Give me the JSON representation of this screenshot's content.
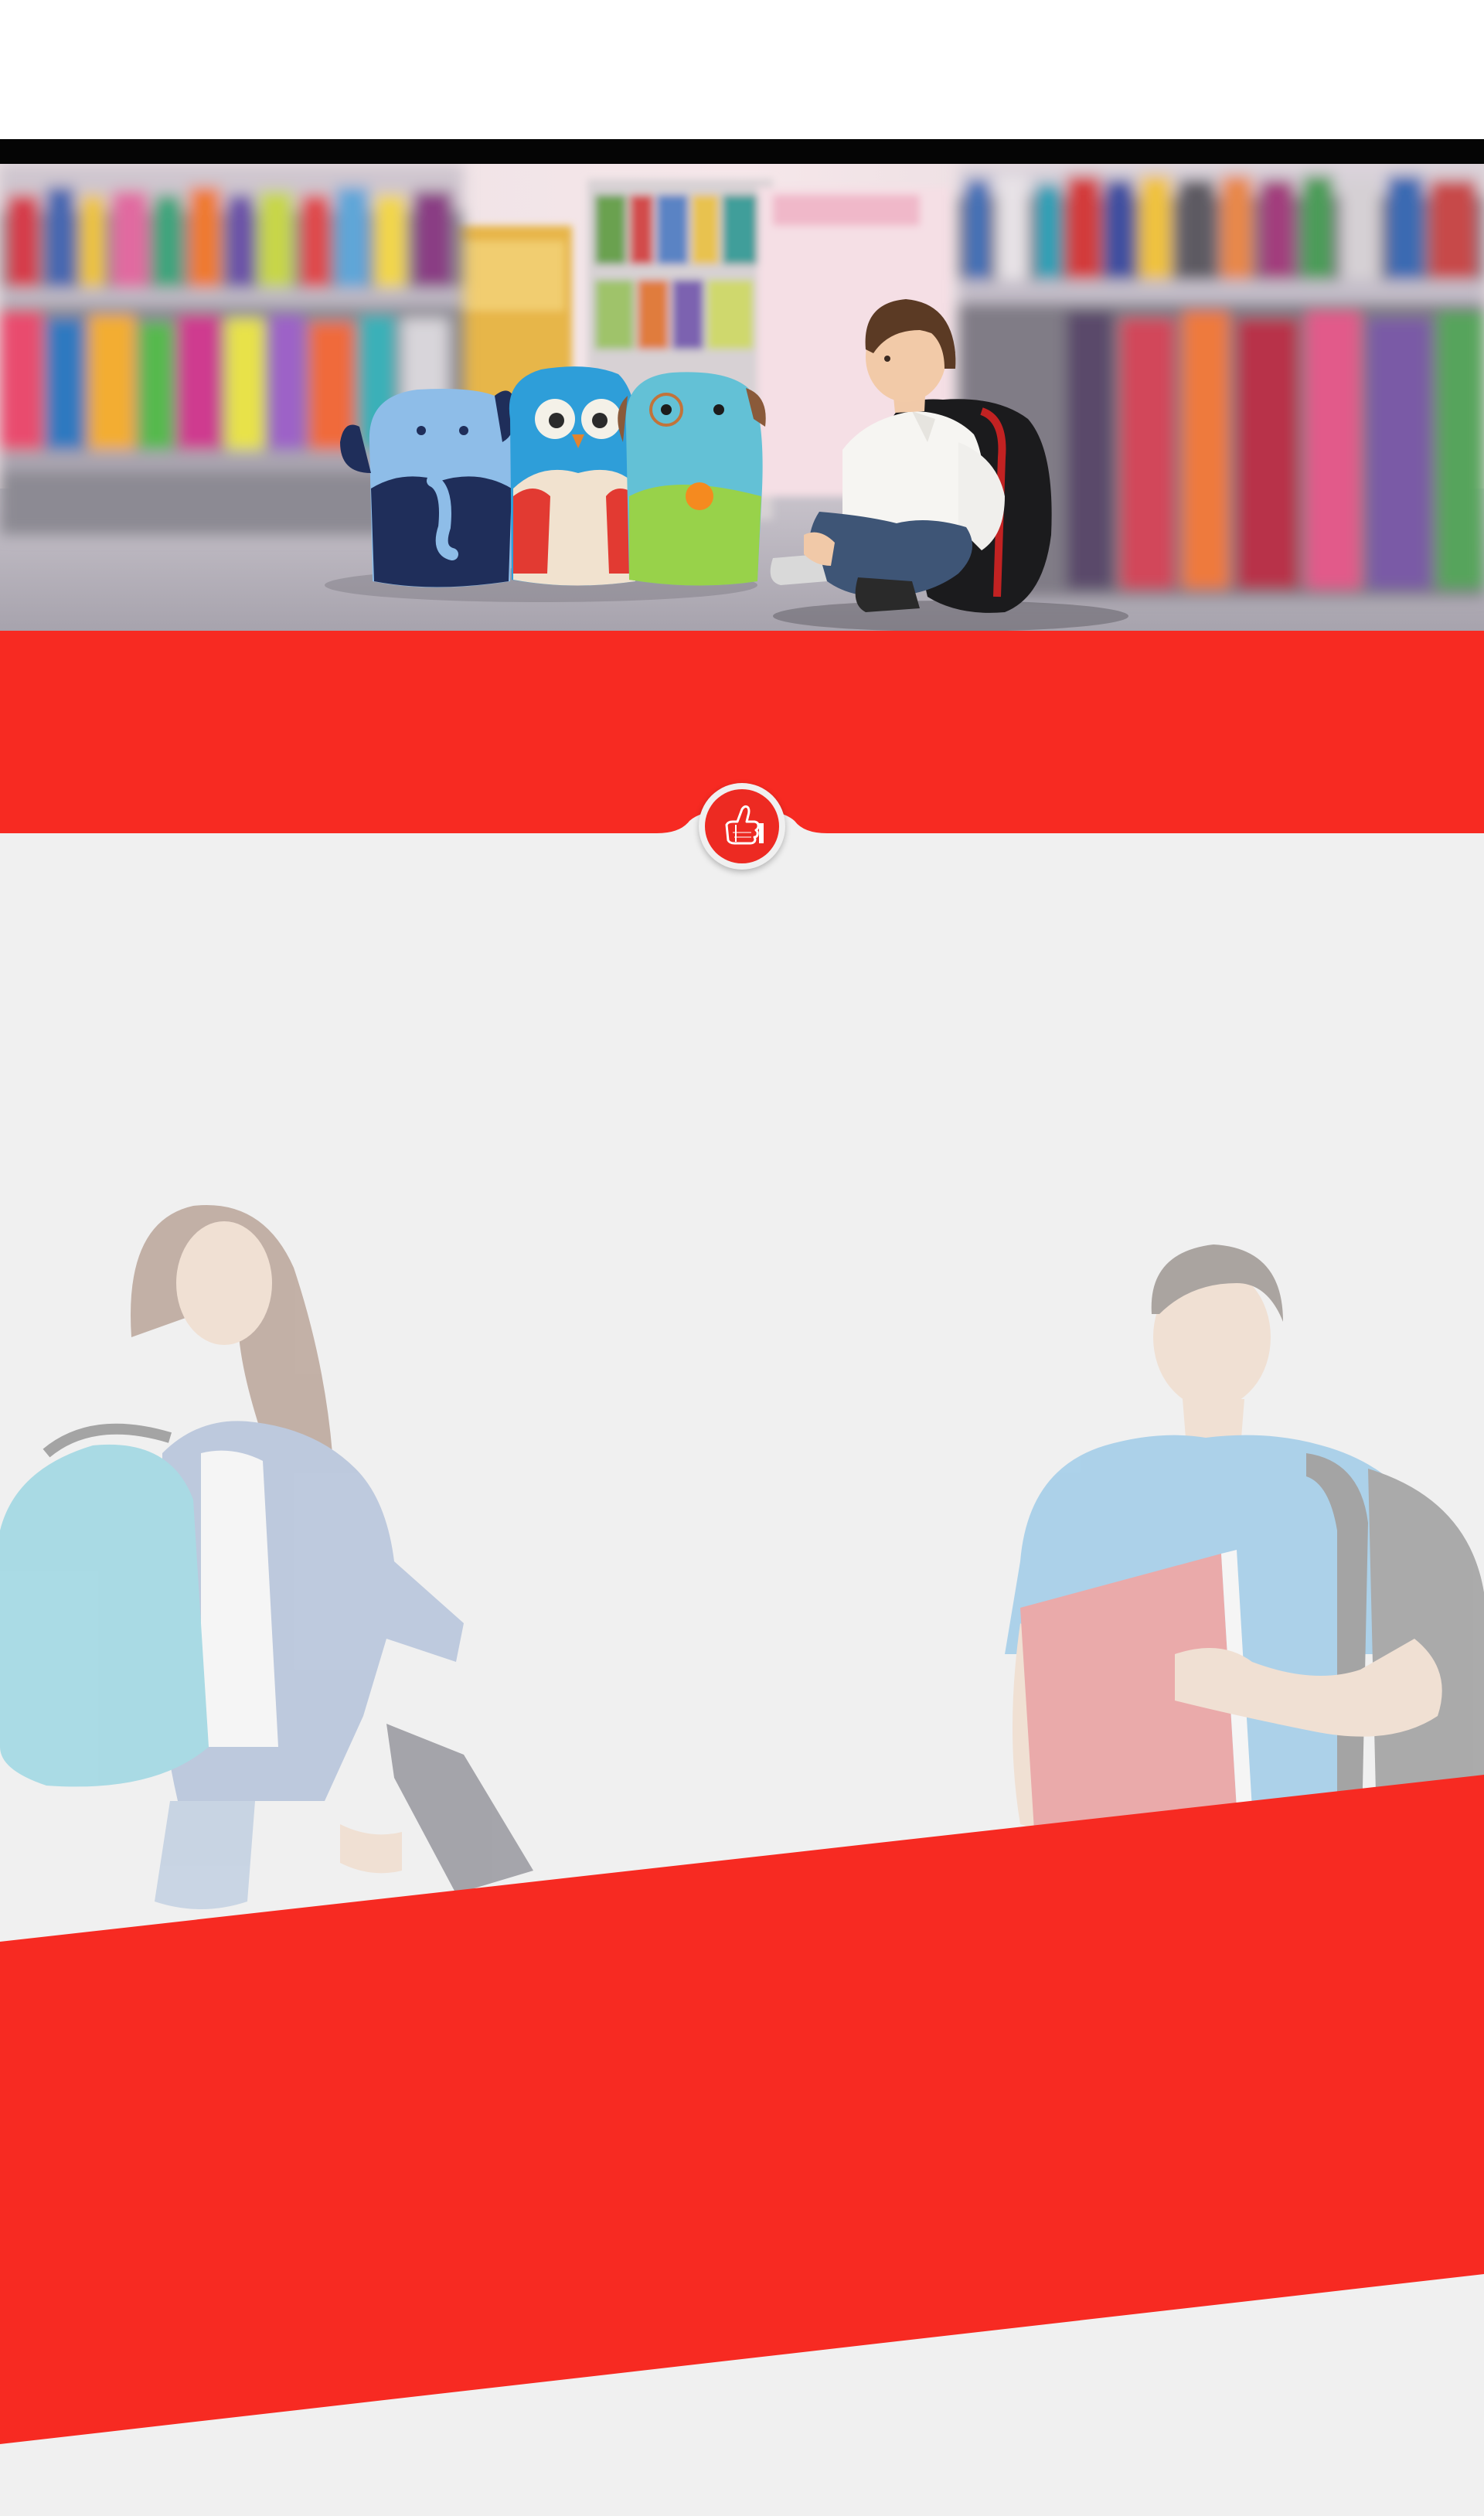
{
  "colors": {
    "brand_red": "#f72a22",
    "badge_red": "#ed2a22",
    "body_grey": "#f0f0f0",
    "top_bar": "#050505"
  },
  "icons": {
    "badge": "thumbs-up-icon"
  }
}
